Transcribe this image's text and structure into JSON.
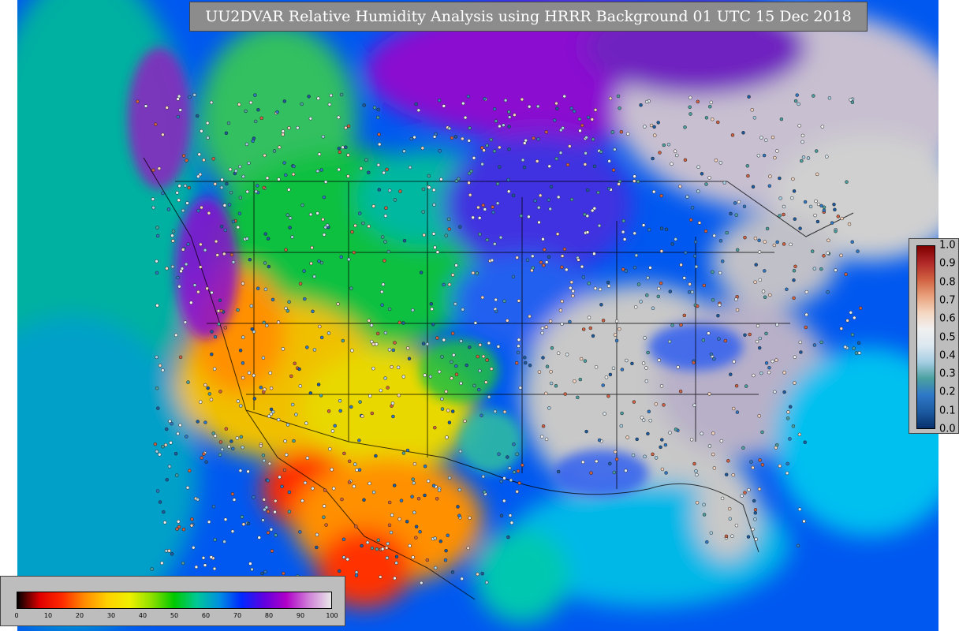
{
  "title": "UU2DVAR Relative Humidity Analysis using HRRR Background 01 UTC 15 Dec 2018",
  "humidity_colorbar": {
    "ticks": [
      "0",
      "10",
      "20",
      "30",
      "40",
      "50",
      "60",
      "70",
      "80",
      "90",
      "100"
    ],
    "range": [
      0,
      100
    ],
    "colors": [
      "#000000",
      "#e00000",
      "#ff2a00",
      "#ff8c00",
      "#ffd000",
      "#f0f000",
      "#8ce000",
      "#00c800",
      "#00c896",
      "#0090e0",
      "#0028ff",
      "#6000e0",
      "#b000c8",
      "#d080d8",
      "#e8e8e8"
    ]
  },
  "obs_colorbar": {
    "ticks": [
      "1.0",
      "0.9",
      "0.8",
      "0.7",
      "0.6",
      "0.5",
      "0.4",
      "0.3",
      "0.2",
      "0.1",
      "0.0"
    ],
    "range": [
      0,
      1
    ],
    "colors": [
      "#08306b",
      "#1c5aa0",
      "#2e78c8",
      "#4aa0a0",
      "#a6cee3",
      "#dce8f0",
      "#f0f0f0",
      "#f5d5c0",
      "#e8a07a",
      "#d06040",
      "#b02828",
      "#800000"
    ]
  }
}
